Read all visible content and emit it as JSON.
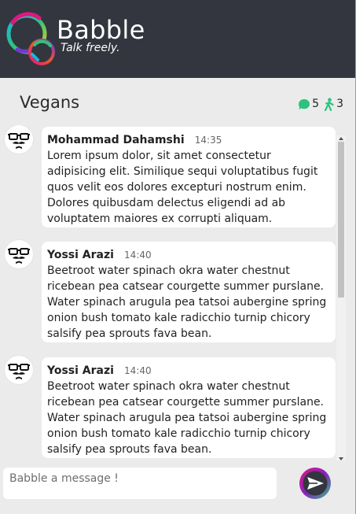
{
  "header": {
    "brand_name": "Babble",
    "tagline": "Talk freely.",
    "logo_icon": "babble-logo-icon"
  },
  "room": {
    "title": "Vegans",
    "messages_count": "5",
    "users_count": "3",
    "messages_icon": "chat-bubble-icon",
    "users_icon": "person-icon"
  },
  "messages": [
    {
      "author": "Mohammad Dahamshi",
      "time": "14:35",
      "text": "Lorem ipsum dolor, sit amet consectetur adipisicing elit. Similique sequi voluptatibus fugit quos velit eos dolores excepturi nostrum enim. Dolores quibusdam delectus eligendi ad ab voluptatem maiores ex corrupti aliquam.",
      "avatar_icon": "moustache-avatar-icon"
    },
    {
      "author": "Yossi Arazi",
      "time": "14:40",
      "text": "Beetroot water spinach okra water chestnut ricebean pea catsear courgette summer purslane. Water spinach arugula pea tatsoi aubergine spring onion bush tomato kale radicchio turnip chicory salsify pea sprouts fava bean.",
      "avatar_icon": "moustache-avatar-icon"
    },
    {
      "author": "Yossi Arazi",
      "time": "14:40",
      "text": "Beetroot water spinach okra water chestnut ricebean pea catsear courgette summer purslane. Water spinach arugula pea tatsoi aubergine spring onion bush tomato kale radicchio turnip chicory salsify pea sprouts fava bean.",
      "avatar_icon": "moustache-avatar-icon"
    }
  ],
  "composer": {
    "placeholder": "Babble a message !",
    "value": ""
  },
  "send_icon": "send-arrow-icon",
  "colors": {
    "header_bg": "#33363e",
    "page_bg": "#ebebeb",
    "accent_green": "#2ec27e",
    "accent_magenta": "#e0177f",
    "accent_cyan": "#17b7e0",
    "accent_purple": "#6e3ad6"
  }
}
